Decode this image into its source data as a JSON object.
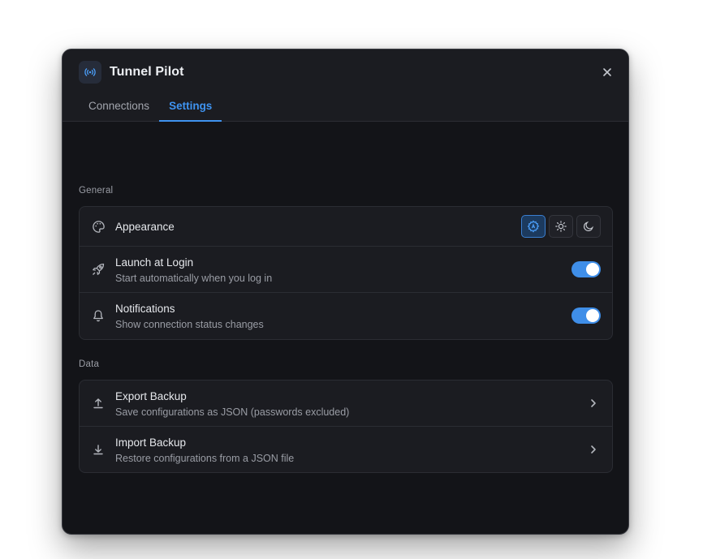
{
  "app": {
    "title": "Tunnel Pilot",
    "icon": "broadcast-icon"
  },
  "tabs": [
    {
      "label": "Connections",
      "active": false
    },
    {
      "label": "Settings",
      "active": true
    }
  ],
  "sections": {
    "general": {
      "label": "General",
      "appearance": {
        "title": "Appearance",
        "icon": "palette-icon",
        "options": [
          "auto-theme-icon",
          "sun-icon",
          "moon-icon"
        ],
        "selected": "auto-theme-icon"
      },
      "launch_at_login": {
        "title": "Launch at Login",
        "subtitle": "Start automatically when you log in",
        "icon": "rocket-icon",
        "enabled": true
      },
      "notifications": {
        "title": "Notifications",
        "subtitle": "Show connection status changes",
        "icon": "bell-icon",
        "enabled": true
      }
    },
    "data": {
      "label": "Data",
      "export": {
        "title": "Export Backup",
        "subtitle": "Save configurations as JSON (passwords excluded)",
        "icon": "upload-icon"
      },
      "import": {
        "title": "Import Backup",
        "subtitle": "Restore configurations from a JSON file",
        "icon": "download-icon"
      }
    }
  },
  "colors": {
    "accent": "#3f93f0",
    "window_bg": "#131418",
    "card_bg": "#1b1c21",
    "toggle_on": "#3f8ee8"
  }
}
